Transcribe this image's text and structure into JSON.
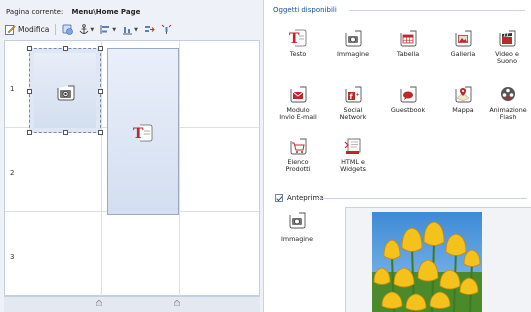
{
  "header": {
    "page_label": "Pagina corrente:",
    "page_value": "Menu\\Home Page"
  },
  "toolbar": {
    "edit_label": "Modifica"
  },
  "grid": {
    "rows": [
      "1",
      "2",
      "3"
    ]
  },
  "objects": {
    "title": "Oggetti disponibili",
    "items": [
      {
        "label": "Testo",
        "icon": "text-icon"
      },
      {
        "label": "Immagine",
        "icon": "camera-icon"
      },
      {
        "label": "Tabella",
        "icon": "table-icon"
      },
      {
        "label": "Galleria",
        "icon": "gallery-icon"
      },
      {
        "label": "Video e Suono",
        "icon": "video-icon"
      },
      {
        "label": "Modulo Invio E-mail",
        "icon": "email-form-icon"
      },
      {
        "label": "Social Network",
        "icon": "social-network-icon"
      },
      {
        "label": "Guestbook",
        "icon": "guestbook-icon"
      },
      {
        "label": "Mappa",
        "icon": "map-icon"
      },
      {
        "label": "Animazione Flash",
        "icon": "flash-icon"
      },
      {
        "label": "Elenco Prodotti",
        "icon": "products-icon"
      },
      {
        "label": "HTML e Widgets",
        "icon": "html-widgets-icon"
      }
    ]
  },
  "preview": {
    "label": "Anteprima",
    "checked": true,
    "item_label": "Immagine"
  },
  "colors": {
    "accent": "#1b4fa0",
    "text_red": "#c0272d",
    "panel_bg": "#eef2f8"
  }
}
